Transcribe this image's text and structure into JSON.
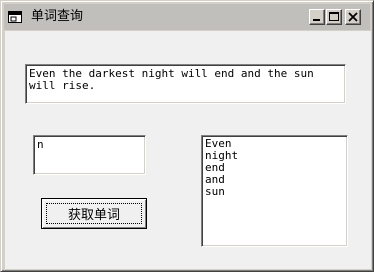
{
  "window": {
    "title": "单词查询",
    "icon": "app-window-icon",
    "controls": {
      "minimize": "minimize-icon",
      "maximize": "maximize-icon",
      "close": "close-icon"
    }
  },
  "sentence": {
    "value": "Even the darkest night will end and the sun will rise."
  },
  "word_input": {
    "value": "n"
  },
  "results": {
    "items": [
      "Even",
      "night",
      "end",
      "and",
      "sun"
    ]
  },
  "action_button": {
    "label": "获取单词"
  }
}
